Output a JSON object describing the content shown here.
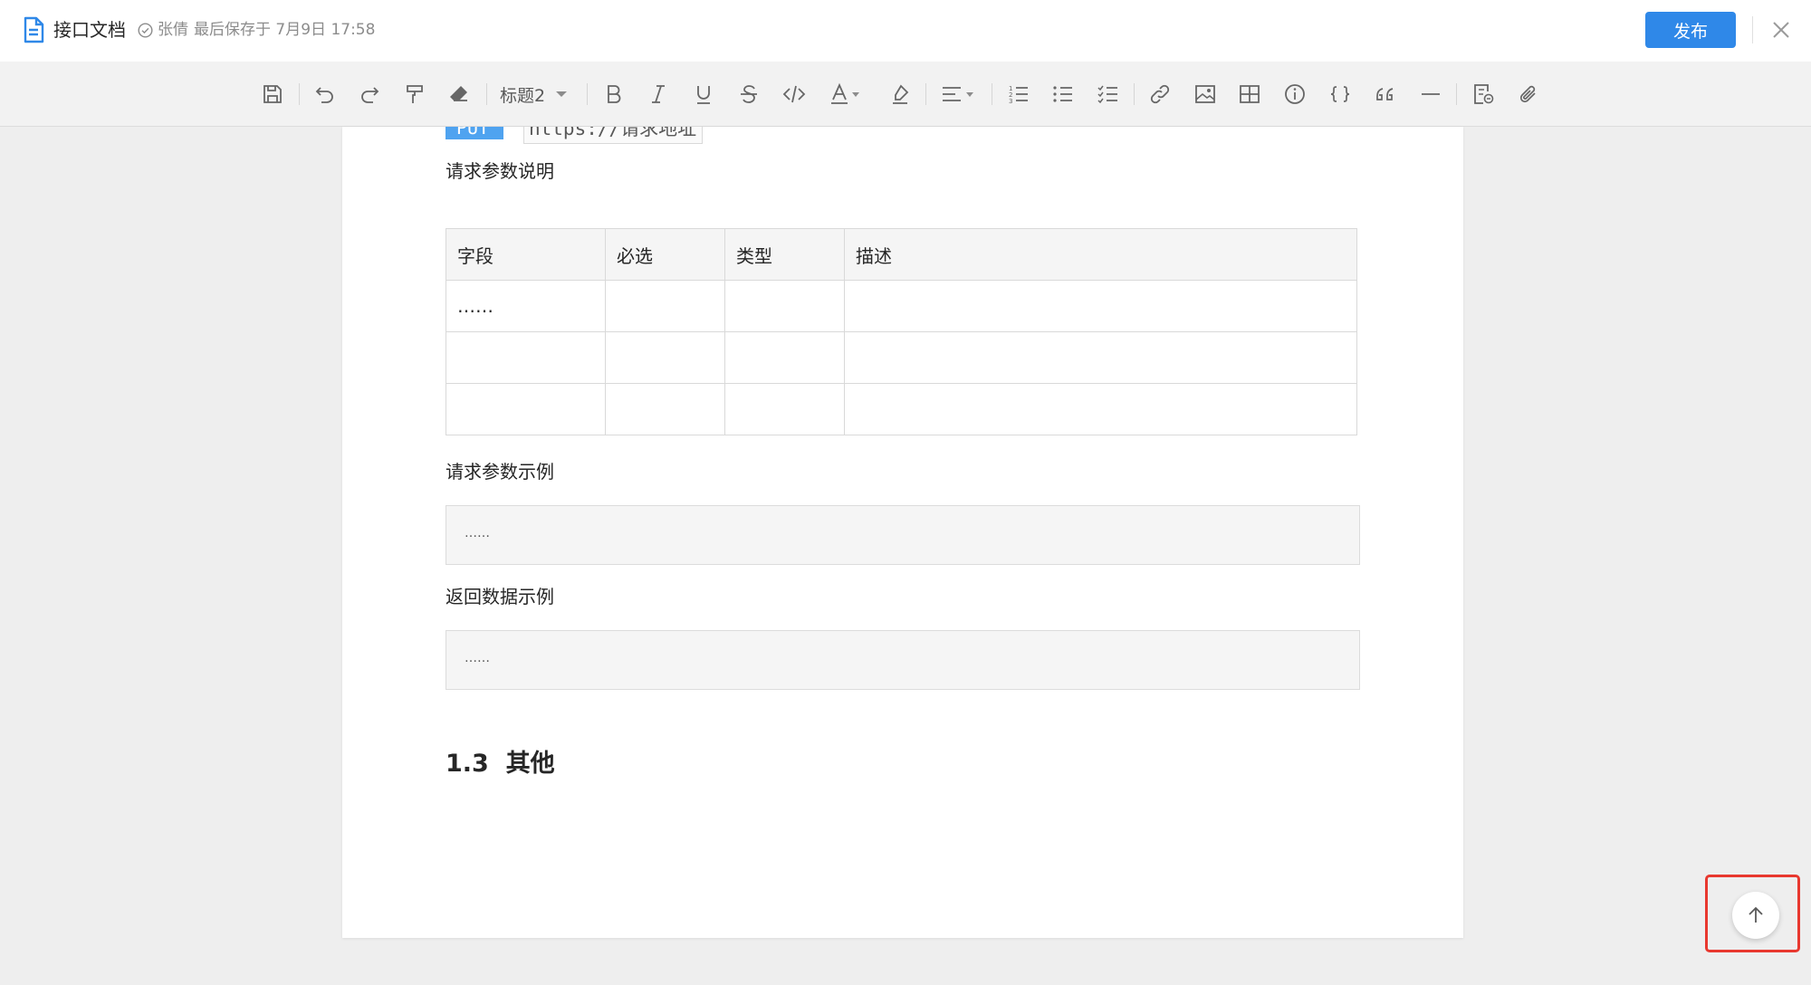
{
  "header": {
    "doc_title": "接口文档",
    "author": "张倩",
    "save_text": "最后保存于 7月9日 17:58",
    "publish_label": "发布"
  },
  "toolbar": {
    "heading_select": "标题2",
    "icons": [
      "save-icon",
      "undo-icon",
      "redo-icon",
      "format-painter-icon",
      "eraser-icon",
      "bold-icon",
      "italic-icon",
      "underline-icon",
      "strikethrough-icon",
      "code-icon",
      "font-color-icon",
      "highlight-icon",
      "align-icon",
      "ordered-list-icon",
      "bullet-list-icon",
      "task-list-icon",
      "link-icon",
      "image-icon",
      "table-icon",
      "info-icon",
      "code-block-icon",
      "quote-icon",
      "divider-icon",
      "template-icon",
      "attachment-icon"
    ]
  },
  "doc": {
    "method": "PUT",
    "url": "https://请求地址",
    "params_label": "请求参数说明",
    "table": {
      "headers": [
        "字段",
        "必选",
        "类型",
        "描述"
      ],
      "rows": [
        [
          "……",
          "",
          "",
          ""
        ],
        [
          "",
          "",
          "",
          ""
        ],
        [
          "",
          "",
          "",
          ""
        ]
      ]
    },
    "request_example_label": "请求参数示例",
    "request_example": "……",
    "response_example_label": "返回数据示例",
    "response_example": "……",
    "section_heading": "1.3  其他"
  },
  "colors": {
    "primary": "#2f88e8",
    "method_badge": "#4fa3f0",
    "highlight_border": "#e8382f"
  }
}
